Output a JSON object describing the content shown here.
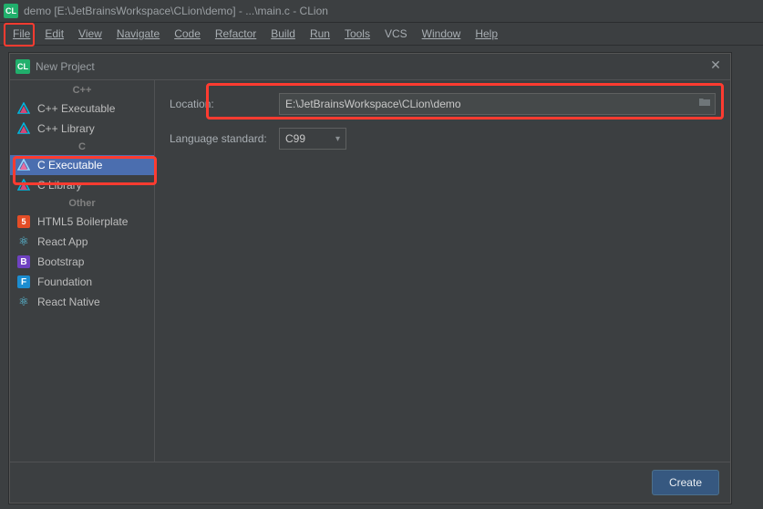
{
  "window": {
    "title": "demo [E:\\JetBrainsWorkspace\\CLion\\demo] - ...\\main.c - CLion",
    "app_icon": "CL"
  },
  "menu": {
    "file": "File",
    "edit": "Edit",
    "view": "View",
    "navigate": "Navigate",
    "code": "Code",
    "refactor": "Refactor",
    "build": "Build",
    "run": "Run",
    "tools": "Tools",
    "vcs": "VCS",
    "window": "Window",
    "help": "Help"
  },
  "dialog": {
    "icon": "CL",
    "title": "New Project",
    "close": "✕"
  },
  "sidebar": {
    "heading_cpp": "C++",
    "heading_c": "C",
    "heading_other": "Other",
    "cpp_exec": "C++ Executable",
    "cpp_lib": "C++ Library",
    "c_exec": "C Executable",
    "c_lib": "C Library",
    "html5": "HTML5 Boilerplate",
    "react_app": "React App",
    "bootstrap": "Bootstrap",
    "foundation": "Foundation",
    "react_native": "React Native",
    "icon_html5": "5",
    "icon_react": "⚛",
    "icon_bootstrap": "B",
    "icon_foundation": "F"
  },
  "form": {
    "location_label": "Location:",
    "location_value": "E:\\JetBrainsWorkspace\\CLion\\demo",
    "lang_label": "Language standard:",
    "lang_value": "C99"
  },
  "footer": {
    "create": "Create"
  }
}
